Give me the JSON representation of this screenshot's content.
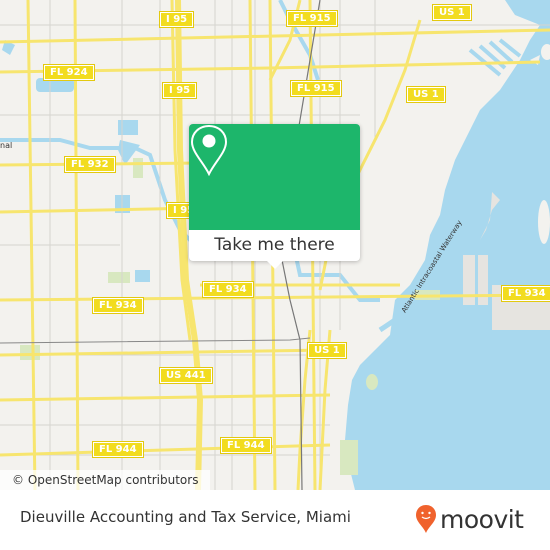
{
  "map": {
    "road_labels": [
      {
        "id": "i95-top",
        "text": "I 95"
      },
      {
        "id": "fl915-top",
        "text": "FL 915"
      },
      {
        "id": "us1-top",
        "text": "US 1"
      },
      {
        "id": "fl924",
        "text": "FL 924"
      },
      {
        "id": "i95-mid",
        "text": "I 95"
      },
      {
        "id": "fl915-mid",
        "text": "FL 915"
      },
      {
        "id": "us1-mid",
        "text": "US 1"
      },
      {
        "id": "fl932",
        "text": "FL 932"
      },
      {
        "id": "i95-low",
        "text": "I 95"
      },
      {
        "id": "fl934-left",
        "text": "FL 934"
      },
      {
        "id": "fl934-center",
        "text": "FL 934"
      },
      {
        "id": "fl934-right",
        "text": "FL 934"
      },
      {
        "id": "us1-low",
        "text": "US 1"
      },
      {
        "id": "us441",
        "text": "US 441"
      },
      {
        "id": "fl944-left",
        "text": "FL 944"
      },
      {
        "id": "fl944-right",
        "text": "FL 944"
      }
    ],
    "waterway_label": "Atlantic Intracoastal Waterway",
    "edge_label": "nal",
    "attribution": "© OpenStreetMap contributors",
    "colors": {
      "land": "#f3f2ee",
      "water": "#a8d8ee",
      "major_road": "#f7e56e",
      "minor_road": "#d6d4cf",
      "park": "#d8e8c0",
      "rail": "#777777"
    }
  },
  "popup": {
    "icon": "map-pin-icon",
    "button_label": "Take me there",
    "accent": "#1db66b"
  },
  "footer": {
    "place_name": "Dieuville Accounting and Tax Service, Miami",
    "logo_text": "moovit",
    "logo_color": "#f0622d"
  }
}
